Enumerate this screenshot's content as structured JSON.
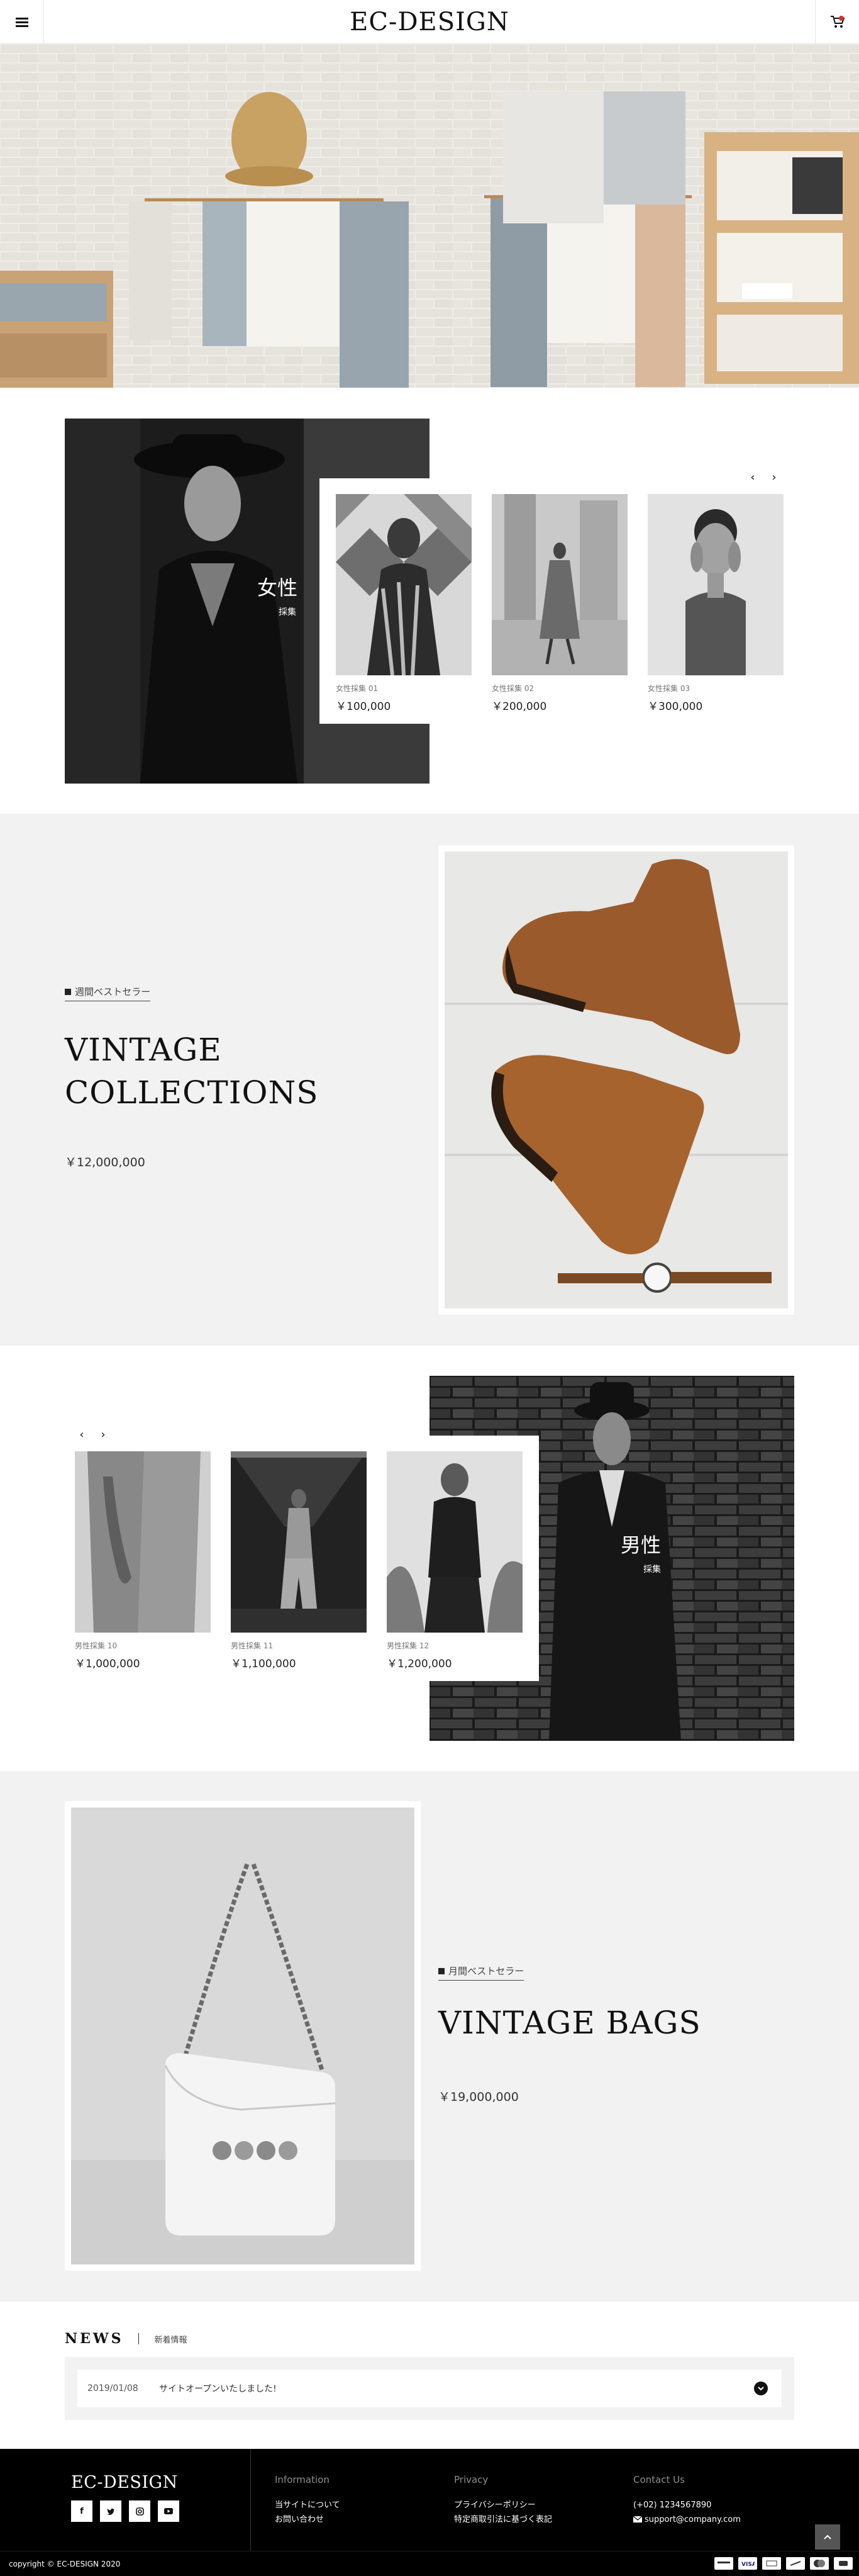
{
  "header": {
    "logo": "EC-DESIGN",
    "menu_icon": "hamburger-icon",
    "cart_icon": "cart-icon"
  },
  "women": {
    "title": "女性",
    "subtitle": "採集",
    "products": [
      {
        "name": "女性採集 01",
        "price": "￥100,000"
      },
      {
        "name": "女性採集 02",
        "price": "￥200,000"
      },
      {
        "name": "女性採集 03",
        "price": "￥300,000"
      }
    ]
  },
  "feature1": {
    "kicker": "週間ベストセラー",
    "title_line1": "VINTAGE",
    "title_line2": "COLLECTIONS",
    "price": "￥12,000,000"
  },
  "men": {
    "title": "男性",
    "subtitle": "採集",
    "products": [
      {
        "name": "男性採集 10",
        "price": "￥1,000,000"
      },
      {
        "name": "男性採集 11",
        "price": "￥1,100,000"
      },
      {
        "name": "男性採集 12",
        "price": "￥1,200,000"
      }
    ]
  },
  "feature2": {
    "kicker": "月間ベストセラー",
    "title": "VINTAGE BAGS",
    "price": "￥19,000,000"
  },
  "news": {
    "title": "NEWS",
    "subtitle": "新着情報",
    "items": [
      {
        "date": "2019/01/08",
        "text": "サイトオープンいたしました!"
      }
    ]
  },
  "footer": {
    "logo": "EC-DESIGN",
    "socials": [
      "facebook-icon",
      "twitter-icon",
      "instagram-icon",
      "youtube-icon"
    ],
    "information": {
      "heading": "Information",
      "links": [
        "当サイトについて",
        "お問い合わせ"
      ]
    },
    "privacy": {
      "heading": "Privacy",
      "links": [
        "プライバシーポリシー",
        "特定商取引法に基づく表記"
      ]
    },
    "contact": {
      "heading": "Contact Us",
      "phone": "(+02) 1234567890",
      "email": "support@company.com"
    },
    "copyright": "copyright © EC-DESIGN 2020",
    "payments": [
      "card-icon",
      "visa-icon",
      "card-icon",
      "card-icon",
      "mastercard-icon",
      "card-icon"
    ]
  },
  "colors": {
    "text": "#222222",
    "gray_section": "#f2f2f2",
    "footer": "#000000"
  }
}
